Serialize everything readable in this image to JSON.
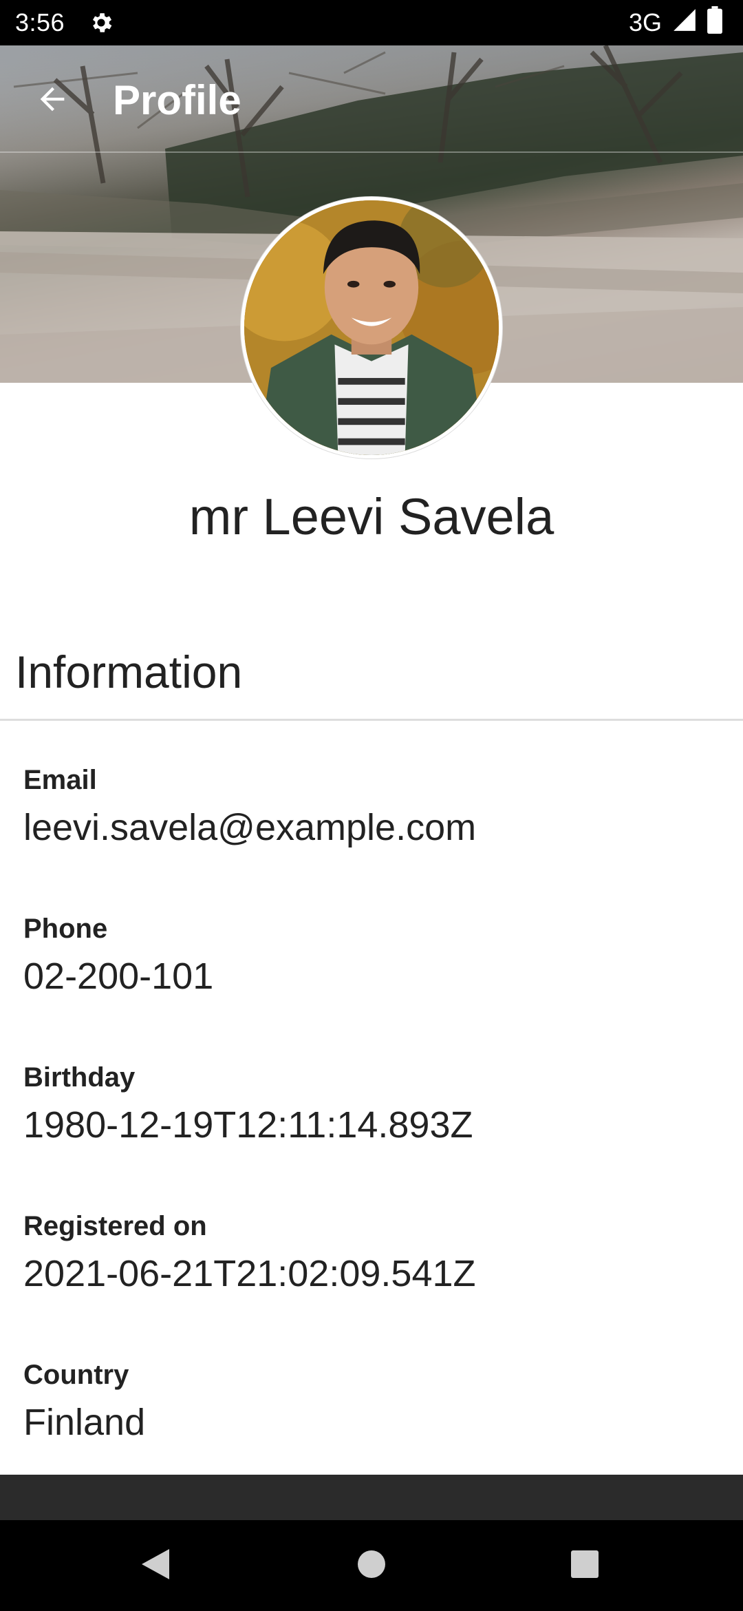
{
  "status_bar": {
    "time": "3:56",
    "network": "3G",
    "icons": [
      "gear-icon",
      "signal-icon",
      "battery-icon"
    ]
  },
  "toolbar": {
    "title": "Profile",
    "back_icon": "arrow-back-icon"
  },
  "profile": {
    "name": "mr Leevi Savela"
  },
  "section": {
    "title": "Information"
  },
  "fields": [
    {
      "label": "Email",
      "value": "leevi.savela@example.com"
    },
    {
      "label": "Phone",
      "value": "02-200-101"
    },
    {
      "label": "Birthday",
      "value": "1980-12-19T12:11:14.893Z"
    },
    {
      "label": "Registered on",
      "value": "2021-06-21T21:02:09.541Z"
    },
    {
      "label": "Country",
      "value": "Finland"
    }
  ],
  "nav": {
    "icons": [
      "back-triangle-icon",
      "home-circle-icon",
      "recents-square-icon"
    ]
  },
  "colors": {
    "text": "#222222",
    "toolbar_text": "#ffffff",
    "divider": "#dddddd",
    "bottom_strip": "#2b2b2b"
  }
}
